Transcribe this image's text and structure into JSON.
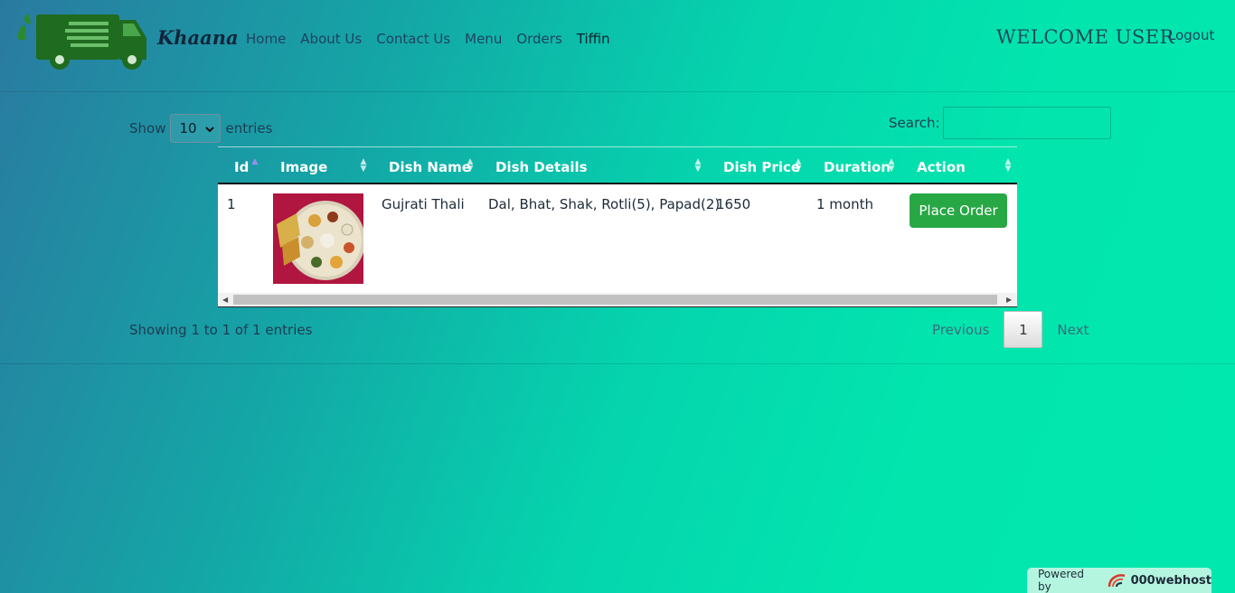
{
  "app": {
    "brand": "Khaana"
  },
  "nav": {
    "items": [
      "Home",
      "About Us",
      "Contact Us",
      "Menu",
      "Orders",
      "Tiffin"
    ]
  },
  "header": {
    "welcome": "WELCOME USER",
    "logout": "Logout"
  },
  "length_control": {
    "prefix": "Show",
    "value": "10",
    "suffix": "entries"
  },
  "search": {
    "label": "Search:",
    "value": ""
  },
  "table": {
    "columns": [
      "Id",
      "Image",
      "Dish Name",
      "Dish Details",
      "Dish Price",
      "Duration",
      "Action"
    ],
    "rows": [
      {
        "id": "1",
        "image": "thali-photo",
        "name": "Gujrati Thali",
        "details": "Dal, Bhat, Shak, Rotli(5), Papad(2)",
        "price": "1650",
        "duration": "1 month",
        "action": "Place Order"
      }
    ]
  },
  "info": "Showing 1 to 1 of 1 entries",
  "pagination": {
    "previous": "Previous",
    "current": "1",
    "next": "Next"
  },
  "footer": {
    "powered_by": "Powered by",
    "host": "000webhost"
  },
  "colors": {
    "accent_green": "#28a745",
    "logo_green": "#1f6b1f"
  }
}
